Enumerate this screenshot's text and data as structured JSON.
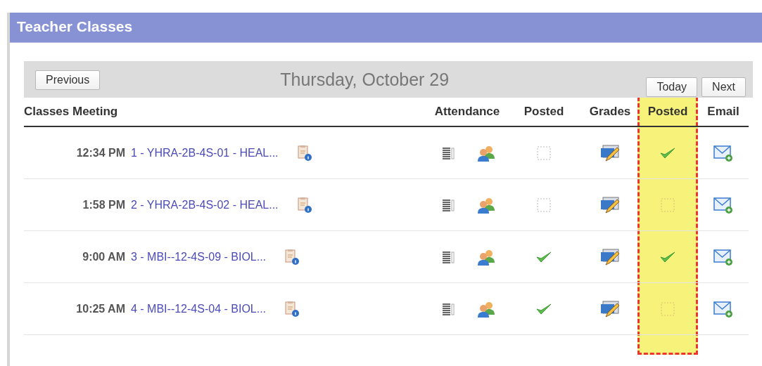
{
  "panel": {
    "title": "Teacher Classes"
  },
  "toolbar": {
    "previous": "Previous",
    "date": "Thursday, October 29",
    "today": "Today",
    "next": "Next"
  },
  "columns": [
    {
      "label": "Classes Meeting",
      "highlighted": false
    },
    {
      "label": "Attendance",
      "highlighted": false
    },
    {
      "label": "Posted",
      "highlighted": false
    },
    {
      "label": "Grades",
      "highlighted": false
    },
    {
      "label": "Posted",
      "highlighted": true
    },
    {
      "label": "Email",
      "highlighted": false
    }
  ],
  "rows": [
    {
      "time": "12:34 PM",
      "class": "1 - YHRA-2B-4S-01 - HEAL...",
      "attendance_posted": false,
      "grades_posted": true
    },
    {
      "time": "1:58 PM",
      "class": "2 - YHRA-2B-4S-02 - HEAL...",
      "attendance_posted": false,
      "grades_posted": false
    },
    {
      "time": "9:00 AM",
      "class": "3 - MBI--12-4S-09 - BIOL...",
      "attendance_posted": true,
      "grades_posted": true
    },
    {
      "time": "10:25 AM",
      "class": "4 - MBI--12-4S-04 - BIOL...",
      "attendance_posted": true,
      "grades_posted": false
    }
  ]
}
